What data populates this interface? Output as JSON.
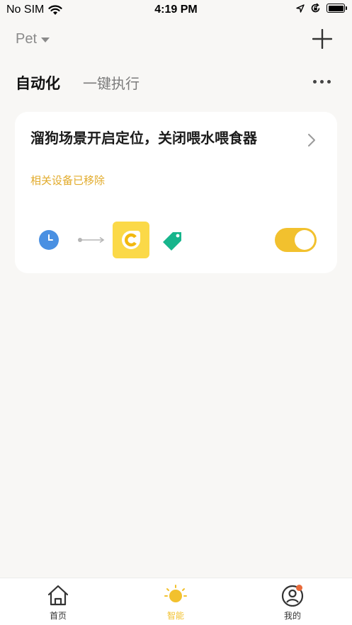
{
  "status_bar": {
    "carrier": "No SIM",
    "time": "4:19 PM",
    "icons": [
      "wifi-icon",
      "location-arrow-icon",
      "rotation-lock-icon",
      "battery-icon"
    ]
  },
  "header": {
    "home_name": "Pet",
    "add_icon": "plus-icon"
  },
  "tabs": {
    "automation": "自动化",
    "tap_to_run": "一键执行",
    "more_icon": "more-dots-icon"
  },
  "scene_card": {
    "title": "溜狗场景开启定位，关闭喂水喂食器",
    "subtitle": "相关设备已移除",
    "subtitle_color": "#e2ab2b",
    "icons": [
      "clock-icon",
      "arrow-right-icon",
      "device-icon",
      "tag-icon",
      "chevron-right-icon"
    ],
    "enabled": true,
    "toggle_color": "#f2c12e"
  },
  "tab_bar": {
    "items": [
      {
        "label": "首页",
        "icon": "home-icon",
        "active": false
      },
      {
        "label": "智能",
        "icon": "sun-icon",
        "active": true
      },
      {
        "label": "我的",
        "icon": "profile-icon",
        "active": false,
        "badge": true
      }
    ],
    "active_color": "#f2c12e"
  }
}
